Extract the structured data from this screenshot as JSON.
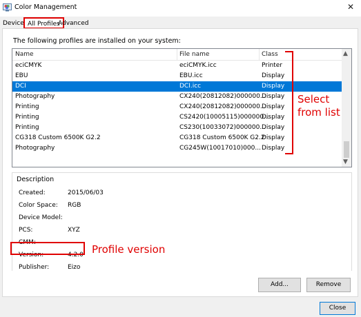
{
  "window": {
    "title": "Color Management",
    "close_glyph": "✕"
  },
  "tabs": [
    {
      "label": "Devices"
    },
    {
      "label": "All Profiles"
    },
    {
      "label": "Advanced"
    }
  ],
  "profiles": {
    "intro": "The following profiles are installed on your system:",
    "columns": [
      "Name",
      "File name",
      "Class"
    ],
    "rows": [
      {
        "name": "eciCMYK",
        "file": "eciCMYK.icc",
        "class": "Printer",
        "selected": false
      },
      {
        "name": "EBU",
        "file": "EBU.icc",
        "class": "Display",
        "selected": false
      },
      {
        "name": "DCI",
        "file": "DCI.icc",
        "class": "Display",
        "selected": true
      },
      {
        "name": "Photography",
        "file": "CX240(20812082)000000...",
        "class": "Display",
        "selected": false
      },
      {
        "name": "Printing",
        "file": "CX240(20812082)000000...",
        "class": "Display",
        "selected": false
      },
      {
        "name": "Printing",
        "file": "CS2420(10005115)000000...",
        "class": "Display",
        "selected": false
      },
      {
        "name": "Printing",
        "file": "CS230(10033072)000000...",
        "class": "Display",
        "selected": false
      },
      {
        "name": "CG318 Custom 6500K G2.2",
        "file": "CG318 Custom 6500K G2.2",
        "class": "Display",
        "selected": false
      },
      {
        "name": "Photography",
        "file": "CG245W(10017010)000...",
        "class": "Display",
        "selected": false
      }
    ]
  },
  "description": {
    "legend": "Description",
    "properties": [
      {
        "label": "Created:",
        "value": "2015/06/03"
      },
      {
        "label": "Color Space:",
        "value": "RGB"
      },
      {
        "label": "Device Model:",
        "value": ""
      },
      {
        "label": "PCS:",
        "value": "XYZ"
      },
      {
        "label": "CMM:",
        "value": ""
      },
      {
        "label": "Version:",
        "value": "4.2.0"
      },
      {
        "label": "Publisher:",
        "value": "Eizo"
      }
    ]
  },
  "buttons": {
    "add": "Add...",
    "remove": "Remove",
    "close": "Close"
  },
  "annotations": {
    "select_line1": "Select",
    "select_line2": "from list",
    "version": "Profile version"
  },
  "colors": {
    "selection": "#0078d7",
    "annotation_red": "#e00000"
  }
}
